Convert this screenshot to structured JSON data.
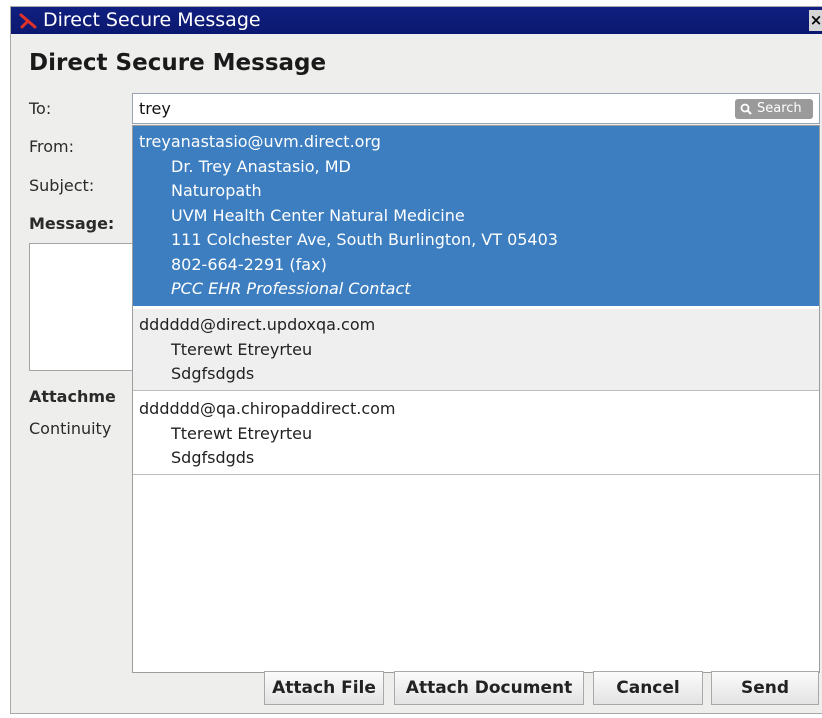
{
  "window": {
    "title": "Direct Secure Message",
    "close_glyph": "×",
    "icon": "app-x-icon"
  },
  "form": {
    "heading": "Direct Secure Message",
    "to_label": "To:",
    "to_value": "trey",
    "search_label": "Search",
    "from_label": "From:",
    "subject_label": "Subject:",
    "message_label": "Message:",
    "attachments_label": "Attachme",
    "attachments_item": "Continuity"
  },
  "dropdown": {
    "entries": [
      {
        "email": "treyanastasio@uvm.direct.org",
        "lines": [
          "Dr. Trey Anastasio, MD",
          "Naturopath",
          "UVM Health Center Natural Medicine",
          "111 Colchester Ave, South Burlington, VT 05403",
          "802-664-2291 (fax)"
        ],
        "type": "PCC EHR Professional Contact",
        "selected": true
      },
      {
        "email": "dddddd@direct.updoxqa.com",
        "lines": [
          "Tterewt Etreyrteu",
          "Sdgfsdgds"
        ]
      },
      {
        "email": "dddddd@qa.chiropaddirect.com",
        "lines": [
          "Tterewt Etreyrteu",
          "Sdgfsdgds"
        ]
      }
    ]
  },
  "buttons": {
    "attach_file": "Attach File",
    "attach_document": "Attach Document",
    "cancel": "Cancel",
    "send": "Send"
  },
  "colors": {
    "titlebar": "#0b1870",
    "selection": "#3d7ec0",
    "icon_red": "#e0322b"
  }
}
